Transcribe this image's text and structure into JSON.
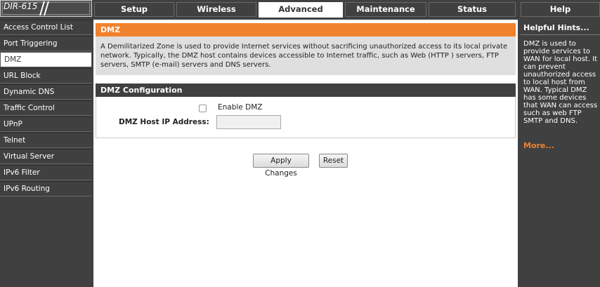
{
  "logo": {
    "model": "DIR-615"
  },
  "tabs": [
    {
      "label": "Setup",
      "active": false
    },
    {
      "label": "Wireless",
      "active": false
    },
    {
      "label": "Advanced",
      "active": true
    },
    {
      "label": "Maintenance",
      "active": false
    },
    {
      "label": "Status",
      "active": false
    }
  ],
  "help_tab": "Help",
  "sidebar": {
    "items": [
      {
        "label": "Access Control List"
      },
      {
        "label": "Port Triggering"
      },
      {
        "label": "DMZ",
        "active": true
      },
      {
        "label": "URL Block"
      },
      {
        "label": "Dynamic DNS"
      },
      {
        "label": "Traffic Control"
      },
      {
        "label": "UPnP"
      },
      {
        "label": "Telnet"
      },
      {
        "label": "Virtual Server"
      },
      {
        "label": "IPv6 Filter"
      },
      {
        "label": "IPv6 Routing"
      }
    ]
  },
  "main": {
    "section_title": "DMZ",
    "description": "A Demilitarized Zone is used to provide Internet services without sacrificing unauthorized access to its local private network. Typically, the DMZ host contains devices accessible to Internet traffic, such as Web (HTTP ) servers, FTP servers, SMTP (e-mail) servers and DNS servers.",
    "config_title": "DMZ Configuration",
    "enable_label": "Enable DMZ",
    "enable_checked": false,
    "ip_label": "DMZ Host IP Address:",
    "ip_value": "",
    "apply_label": "Apply Changes",
    "reset_label": "Reset"
  },
  "help": {
    "title": "Helpful Hints...",
    "text": "DMZ is used to provide services to WAN for local host. It can prevent unauthorized access to local host from WAN. Typical DMZ has some devices that WAN can access such as web FTP SMTP and DNS.",
    "more": "More..."
  },
  "colors": {
    "accent": "#f0822d",
    "dark": "#404040",
    "active_tab_bg": "#ffffff"
  }
}
